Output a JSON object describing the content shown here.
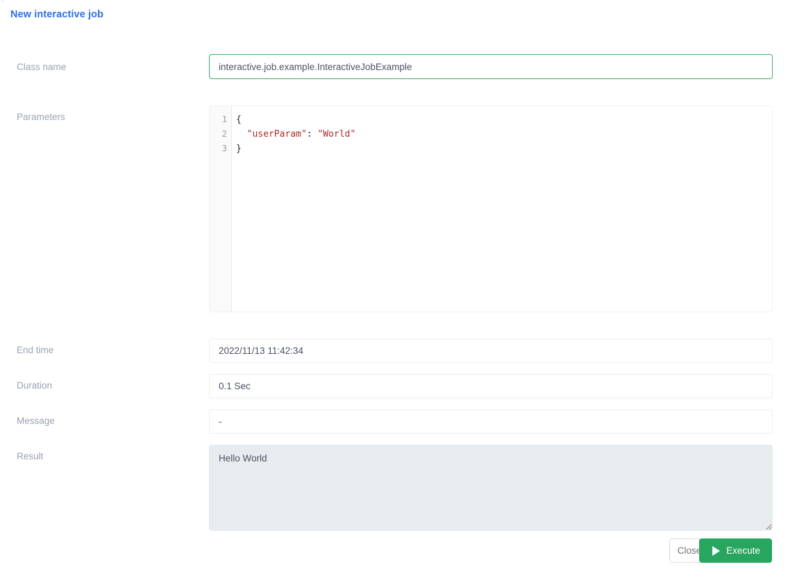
{
  "header": {
    "title": "New interactive job",
    "title_color": "#2f6fe4"
  },
  "form": {
    "class_name": {
      "label": "Class name",
      "value": "interactive.job.example.InteractiveJobExample",
      "placeholder": "Class name",
      "focused": true,
      "focus_border_color": "#42a86b"
    },
    "parameters": {
      "label": "Parameters",
      "line_numbers": [
        "1",
        "2",
        "3"
      ],
      "code_lines": [
        {
          "segments": [
            {
              "text": "{",
              "type": "punct"
            }
          ]
        },
        {
          "segments": [
            {
              "text": "  ",
              "type": "plain"
            },
            {
              "text": "\"userParam\"",
              "type": "string"
            },
            {
              "text": ": ",
              "type": "punct"
            },
            {
              "text": "\"World\"",
              "type": "string"
            }
          ]
        },
        {
          "segments": [
            {
              "text": "}",
              "type": "punct"
            }
          ]
        }
      ],
      "string_color": "#b02a27"
    },
    "end_time": {
      "label": "End time",
      "value": "2022/11/13 11:42:34",
      "placeholder": "End time"
    },
    "duration": {
      "label": "Duration",
      "value": "0.1 Sec",
      "placeholder": "Duration"
    },
    "message": {
      "label": "Message",
      "value": "-",
      "placeholder": "Message"
    },
    "result": {
      "label": "Result",
      "value": "Hello World",
      "placeholder": "Result",
      "background": "#e9ecef"
    }
  },
  "footer": {
    "close_label": "Close",
    "execute_label": "Execute",
    "execute_color": "#28a55f",
    "execute_icon": "play-icon"
  }
}
